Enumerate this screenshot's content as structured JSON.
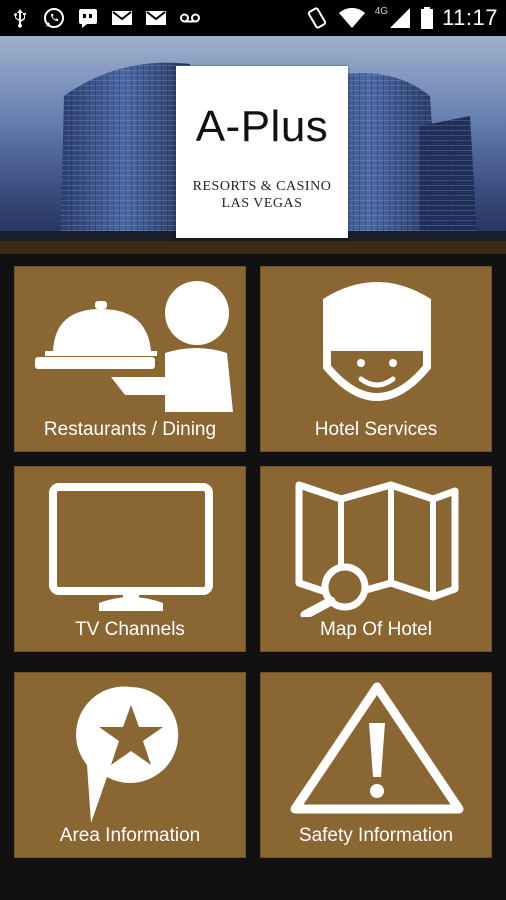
{
  "status_bar": {
    "time": "11:17",
    "network": "4G",
    "left_icons": [
      "usb-icon",
      "whatsapp-icon",
      "hangouts-icon",
      "gmail-icon",
      "gmail-icon",
      "voicemail-icon"
    ],
    "right_icons": [
      "rotate-icon",
      "wifi-icon",
      "signal-icon",
      "battery-icon"
    ]
  },
  "banner": {
    "brand": "A-Plus",
    "subtitle_line1": "RESORTS & CASINO",
    "subtitle_line2": "LAS VEGAS"
  },
  "menu": {
    "tiles": [
      {
        "label": "Restaurants / Dining",
        "icon": "waiter-cloche-icon"
      },
      {
        "label": "Hotel Services",
        "icon": "bellhop-icon"
      },
      {
        "label": "TV Channels",
        "icon": "tv-icon"
      },
      {
        "label": "Map Of Hotel",
        "icon": "map-search-icon"
      },
      {
        "label": "Area Information",
        "icon": "star-speech-bubble-icon"
      },
      {
        "label": "Safety Information",
        "icon": "warning-icon"
      }
    ]
  },
  "colors": {
    "tile_background": "#8a6633",
    "grid_background": "#111111",
    "status_bar": "#000000"
  }
}
